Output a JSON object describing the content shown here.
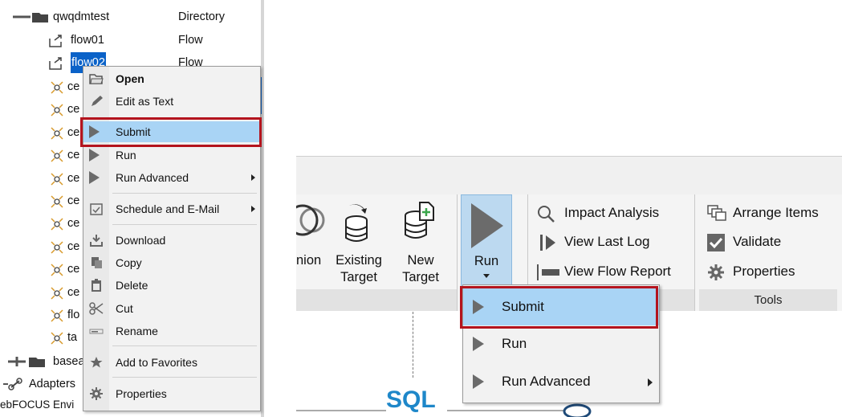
{
  "left": {
    "tree": [
      {
        "name": "qwqdmtest",
        "type": "Directory"
      },
      {
        "name": "flow01",
        "type": "Flow"
      },
      {
        "name": "flow02",
        "type": "Flow",
        "selected": true
      },
      {
        "name": "ce"
      },
      {
        "name": "ce"
      },
      {
        "name": "ce"
      },
      {
        "name": "ce"
      },
      {
        "name": "ce"
      },
      {
        "name": "ce"
      },
      {
        "name": "ce"
      },
      {
        "name": "ce"
      },
      {
        "name": "ce"
      },
      {
        "name": "ce"
      },
      {
        "name": "flo"
      },
      {
        "name": "ta"
      },
      {
        "name": "basea"
      },
      {
        "name": "Adapters"
      },
      {
        "name": "ebFOCUS Envi"
      }
    ],
    "context_menu": [
      {
        "label": "Open",
        "icon": "folder-open-icon"
      },
      {
        "label": "Edit as Text",
        "icon": "pencil-icon"
      },
      {
        "label": "Submit",
        "icon": "play-icon",
        "highlighted": true
      },
      {
        "label": "Run",
        "icon": "play-icon"
      },
      {
        "label": "Run Advanced",
        "icon": "play-icon",
        "submenu": true
      },
      {
        "label": "Schedule and E-Mail",
        "icon": "calendar-icon",
        "submenu": true
      },
      {
        "label": "Download",
        "icon": "download-icon"
      },
      {
        "label": "Copy",
        "icon": "copy-icon"
      },
      {
        "label": "Delete",
        "icon": "trash-icon"
      },
      {
        "label": "Cut",
        "icon": "scissors-icon"
      },
      {
        "label": "Rename",
        "icon": "rename-icon"
      },
      {
        "label": "Add to Favorites",
        "icon": "star-icon"
      },
      {
        "label": "Properties",
        "icon": "gear-icon"
      }
    ]
  },
  "right": {
    "ribbon": {
      "union_label": "nion",
      "existing_target_label": "Existing\nTarget",
      "new_target_label": "New\nTarget",
      "run_label": "Run",
      "impact_analysis": "Impact Analysis",
      "view_last_log": "View Last Log",
      "view_flow_report": "View Flow Report",
      "arrange_items": "Arrange Items",
      "validate": "Validate",
      "properties": "Properties",
      "tools_group": "Tools"
    },
    "run_menu": [
      {
        "label": "Submit",
        "highlighted": true
      },
      {
        "label": "Run"
      },
      {
        "label": "Run Advanced",
        "submenu": true
      }
    ],
    "canvas_sql_label": "SQL"
  },
  "colors": {
    "highlight": "#a9d4f5",
    "callout_red": "#b4141e",
    "selection_blue": "#0a62c8",
    "run_button_bg": "#bcd9f0",
    "sql_text": "#1e87c9"
  }
}
